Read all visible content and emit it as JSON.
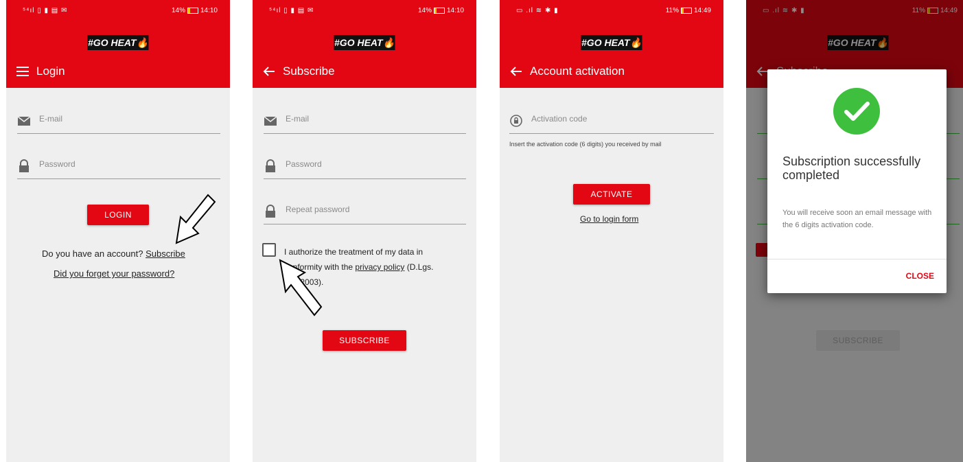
{
  "status": {
    "left_icons": "⁵⁴ıl ▯ ▮ ▤ ✉",
    "left_icons_b": "▭ .ıl ≋ ✱ ▮"
  },
  "screens": {
    "login": {
      "battery": "14%",
      "time": "14:10",
      "logo_text": "#GO HEAT",
      "logo_flame": "🔥",
      "title": "Login",
      "email_placeholder": "E-mail",
      "password_placeholder": "Password",
      "login_button": "LOGIN",
      "account_question": "Do you have an account?",
      "subscribe_link": "Subscribe",
      "forgot_link": "Did you forget your password?"
    },
    "subscribe": {
      "battery": "14%",
      "time": "14:10",
      "title": "Subscribe",
      "email_placeholder": "E-mail",
      "password_placeholder": "Password",
      "repeat_placeholder": "Repeat password",
      "consent_pre": "I authorize the treatment of my data in conformity with the",
      "privacy_link": "privacy policy",
      "consent_post": "(D.Lgs. 196/2003).",
      "subscribe_button": "SUBSCRIBE"
    },
    "activation": {
      "battery": "11%",
      "time": "14:49",
      "title": "Account activation",
      "code_placeholder": "Activation code",
      "hint": "Insert the activation code (6 digits) you received by mail",
      "activate_button": "ACTIVATE",
      "login_link": "Go to login form"
    },
    "success": {
      "battery": "11%",
      "time": "14:49",
      "title_behind": "Subscribe",
      "dialog_title": "Subscription successfully completed",
      "dialog_body": "You will receive soon an email message with the 6 digits activation code.",
      "close_button": "CLOSE",
      "subscribe_button": "SUBSCRIBE"
    }
  },
  "colors": {
    "brand_red": "#e30613",
    "success_green": "#3ec03e"
  },
  "icons": [
    "menu-icon",
    "back-arrow-icon",
    "mail-icon",
    "lock-icon",
    "activation-icon",
    "checkmark-icon"
  ]
}
